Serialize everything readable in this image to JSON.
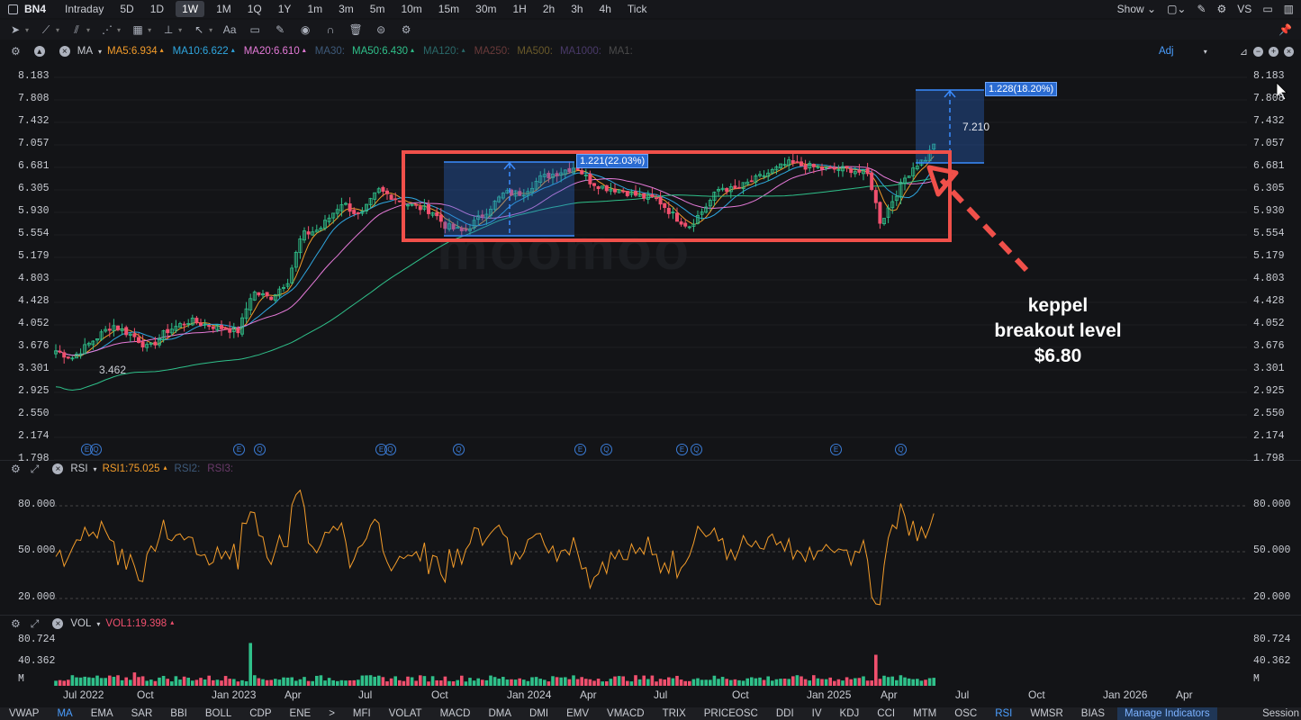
{
  "topbar": {
    "symbol": "BN4",
    "periods": [
      "Intraday",
      "5D",
      "1D",
      "1W",
      "1M",
      "1Q",
      "1Y",
      "1m",
      "3m",
      "5m",
      "10m",
      "15m",
      "30m",
      "1H",
      "2h",
      "3h",
      "4h",
      "Tick"
    ],
    "active_period": "1W",
    "show_label": "Show",
    "vs_label": "VS"
  },
  "ma_legend": {
    "name": "MA",
    "items": [
      {
        "label": "MA5:6.934",
        "color": "#f39c2a"
      },
      {
        "label": "MA10:6.622",
        "color": "#2fa7e0"
      },
      {
        "label": "MA20:6.610",
        "color": "#e57ad8"
      },
      {
        "label": "MA30:",
        "color": "#3e5a7a"
      },
      {
        "label": "MA50:6.430",
        "color": "#2fc08a"
      },
      {
        "label": "MA120:",
        "color": "#2a6a6a"
      },
      {
        "label": "MA250:",
        "color": "#6a3a3a"
      },
      {
        "label": "MA500:",
        "color": "#6a5a2a"
      },
      {
        "label": "MA1000:",
        "color": "#4a3a6a"
      },
      {
        "label": "MA1:",
        "color": "#4a4a4a"
      }
    ],
    "adj": "Adj"
  },
  "price_axis": [
    "8.183",
    "7.808",
    "7.432",
    "7.057",
    "6.681",
    "6.305",
    "5.930",
    "5.554",
    "5.179",
    "4.803",
    "4.428",
    "4.052",
    "3.676",
    "3.301",
    "2.925",
    "2.550",
    "2.174",
    "1.798"
  ],
  "rsi_legend": {
    "name": "RSI",
    "items": [
      {
        "label": "RSI1:75.025",
        "color": "#f39c2a"
      },
      {
        "label": "RSI2:",
        "color": "#3e5a7a"
      },
      {
        "label": "RSI3:",
        "color": "#6a3a6a"
      }
    ]
  },
  "rsi_axis": [
    "80.000",
    "50.000",
    "20.000"
  ],
  "vol_legend": {
    "name": "VOL",
    "items": [
      {
        "label": "VOL1:19.398",
        "color": "#f0506e"
      }
    ]
  },
  "vol_axis": [
    "80.724",
    "40.362",
    "M"
  ],
  "x_axis": [
    "Jul 2022",
    "Oct",
    "Jan 2023",
    "Apr",
    "Jul",
    "Oct",
    "Jan 2024",
    "Apr",
    "Jul",
    "Oct",
    "Jan 2025",
    "Apr",
    "Jul",
    "Oct",
    "Jan 2026",
    "Apr"
  ],
  "events": [
    "E",
    "Q",
    "E",
    "Q",
    "E",
    "Q",
    "E",
    "Q",
    "E",
    "Q",
    "E",
    "Q",
    "E",
    "Q",
    "Q"
  ],
  "chart_annotations": {
    "low_label": "3.462",
    "measure1": "1.221(22.03%)",
    "measure2": "1.228(18.20%)",
    "target_label": "7.210",
    "watermark": "moomoo"
  },
  "annotation": {
    "line1": "keppel",
    "line2": "breakout level",
    "line3": "$6.80"
  },
  "indicators": [
    "VWAP",
    "MA",
    "EMA",
    "SAR",
    "BBI",
    "BOLL",
    "CDP",
    "ENE",
    ">",
    "MFI",
    "VOLAT",
    "MACD",
    "DMA",
    "DMI",
    "EMV",
    "VMACD",
    "TRIX",
    "PRICEOSC",
    "DDI",
    "IV",
    "KDJ",
    "CCI",
    "MTM",
    "OSC",
    "RSI",
    "WMSR",
    "BIAS"
  ],
  "active_indicators": [
    "MA",
    "RSI"
  ],
  "manage_label": "Manage Indicators",
  "session_label": "Session",
  "colors": {
    "up": "#2fc08a",
    "down": "#f0506e",
    "rsi": "#f39c2a",
    "highlight": "#f0504a",
    "measure": "#2a6bd1"
  }
}
